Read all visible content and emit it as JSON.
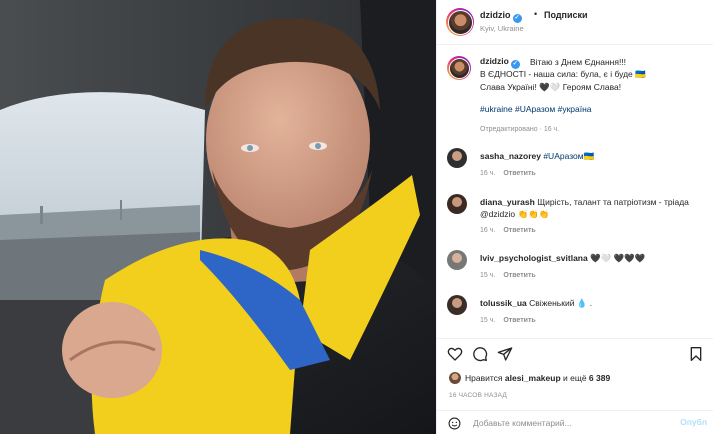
{
  "post": {
    "username": "dzidzio",
    "verified": true,
    "follow_label": "Подписки",
    "location": "Kyiv, Ukraine"
  },
  "caption": {
    "username": "dzidzio",
    "text": "Вітаю з Днем Єднання!!!\nВ ЄДНОСТІ - наша сила: була, є і буде 🇺🇦\nСлава Україні! 🖤🤍 Героям Слава!",
    "hashtags": "#ukraine #UAразом #україна",
    "meta": "Отредактировано · 16 ч."
  },
  "comments": [
    {
      "username": "sasha_nazorey",
      "text": "#UAразом🇺🇦",
      "time": "16 ч.",
      "reply": "Ответить"
    },
    {
      "username": "diana_yurash",
      "text": "Щирість, талант та патріотизм - тріада @dzidzio 👏👏👏",
      "time": "16 ч.",
      "reply": "Ответить"
    },
    {
      "username": "lviv_psychologist_svitlana",
      "text": "🖤🤍 🖤🖤🖤",
      "time": "15 ч.",
      "reply": "Ответить"
    },
    {
      "username": "tolussik_ua",
      "text": "Свіженький 💧 .",
      "time": "15 ч.",
      "reply": "Ответить"
    }
  ],
  "likes": {
    "prefix": "Нравится ",
    "user": "alesi_makeup",
    "middle": " и ещё ",
    "count": "6 389"
  },
  "timestamp": "16 ЧАСОВ НАЗАД",
  "add_comment": {
    "placeholder": "Добавьте комментарий...",
    "post_label": "Опубл"
  },
  "icons": [
    "heart-icon",
    "comment-icon",
    "share-icon",
    "bookmark-icon",
    "emoji-icon",
    "verified-icon"
  ]
}
